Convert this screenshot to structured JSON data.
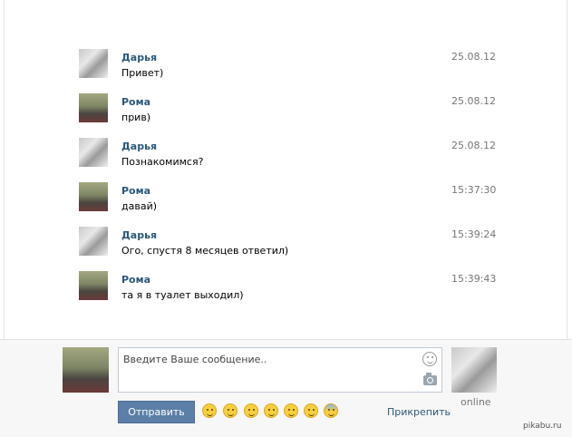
{
  "messages": [
    {
      "author": "Дарья",
      "text": "Привет)",
      "time": "25.08.12",
      "avatar": "darya"
    },
    {
      "author": "Рома",
      "text": "прив)",
      "time": "25.08.12",
      "avatar": "roma"
    },
    {
      "author": "Дарья",
      "text": "Познакомимся?",
      "time": "25.08.12",
      "avatar": "darya"
    },
    {
      "author": "Рома",
      "text": "давай)",
      "time": "15:37:30",
      "avatar": "roma"
    },
    {
      "author": "Дарья",
      "text": "Ого, спустя 8 месяцев ответил)",
      "time": "15:39:24",
      "avatar": "darya"
    },
    {
      "author": "Рома",
      "text": "та я в туалет выходил)",
      "time": "15:39:43",
      "avatar": "roma"
    }
  ],
  "composer": {
    "placeholder": "Введите Ваше сообщение..",
    "send_label": "Отправить",
    "attach_label": "Прикрепить",
    "partner_status": "online",
    "emoji_icons": [
      "laughing-emoji-icon",
      "neutral-emoji-icon",
      "smile-emoji-icon",
      "grin-emoji-icon",
      "relieved-emoji-icon",
      "confused-emoji-icon",
      "scared-emoji-icon"
    ]
  },
  "watermark": "pikabu.ru"
}
